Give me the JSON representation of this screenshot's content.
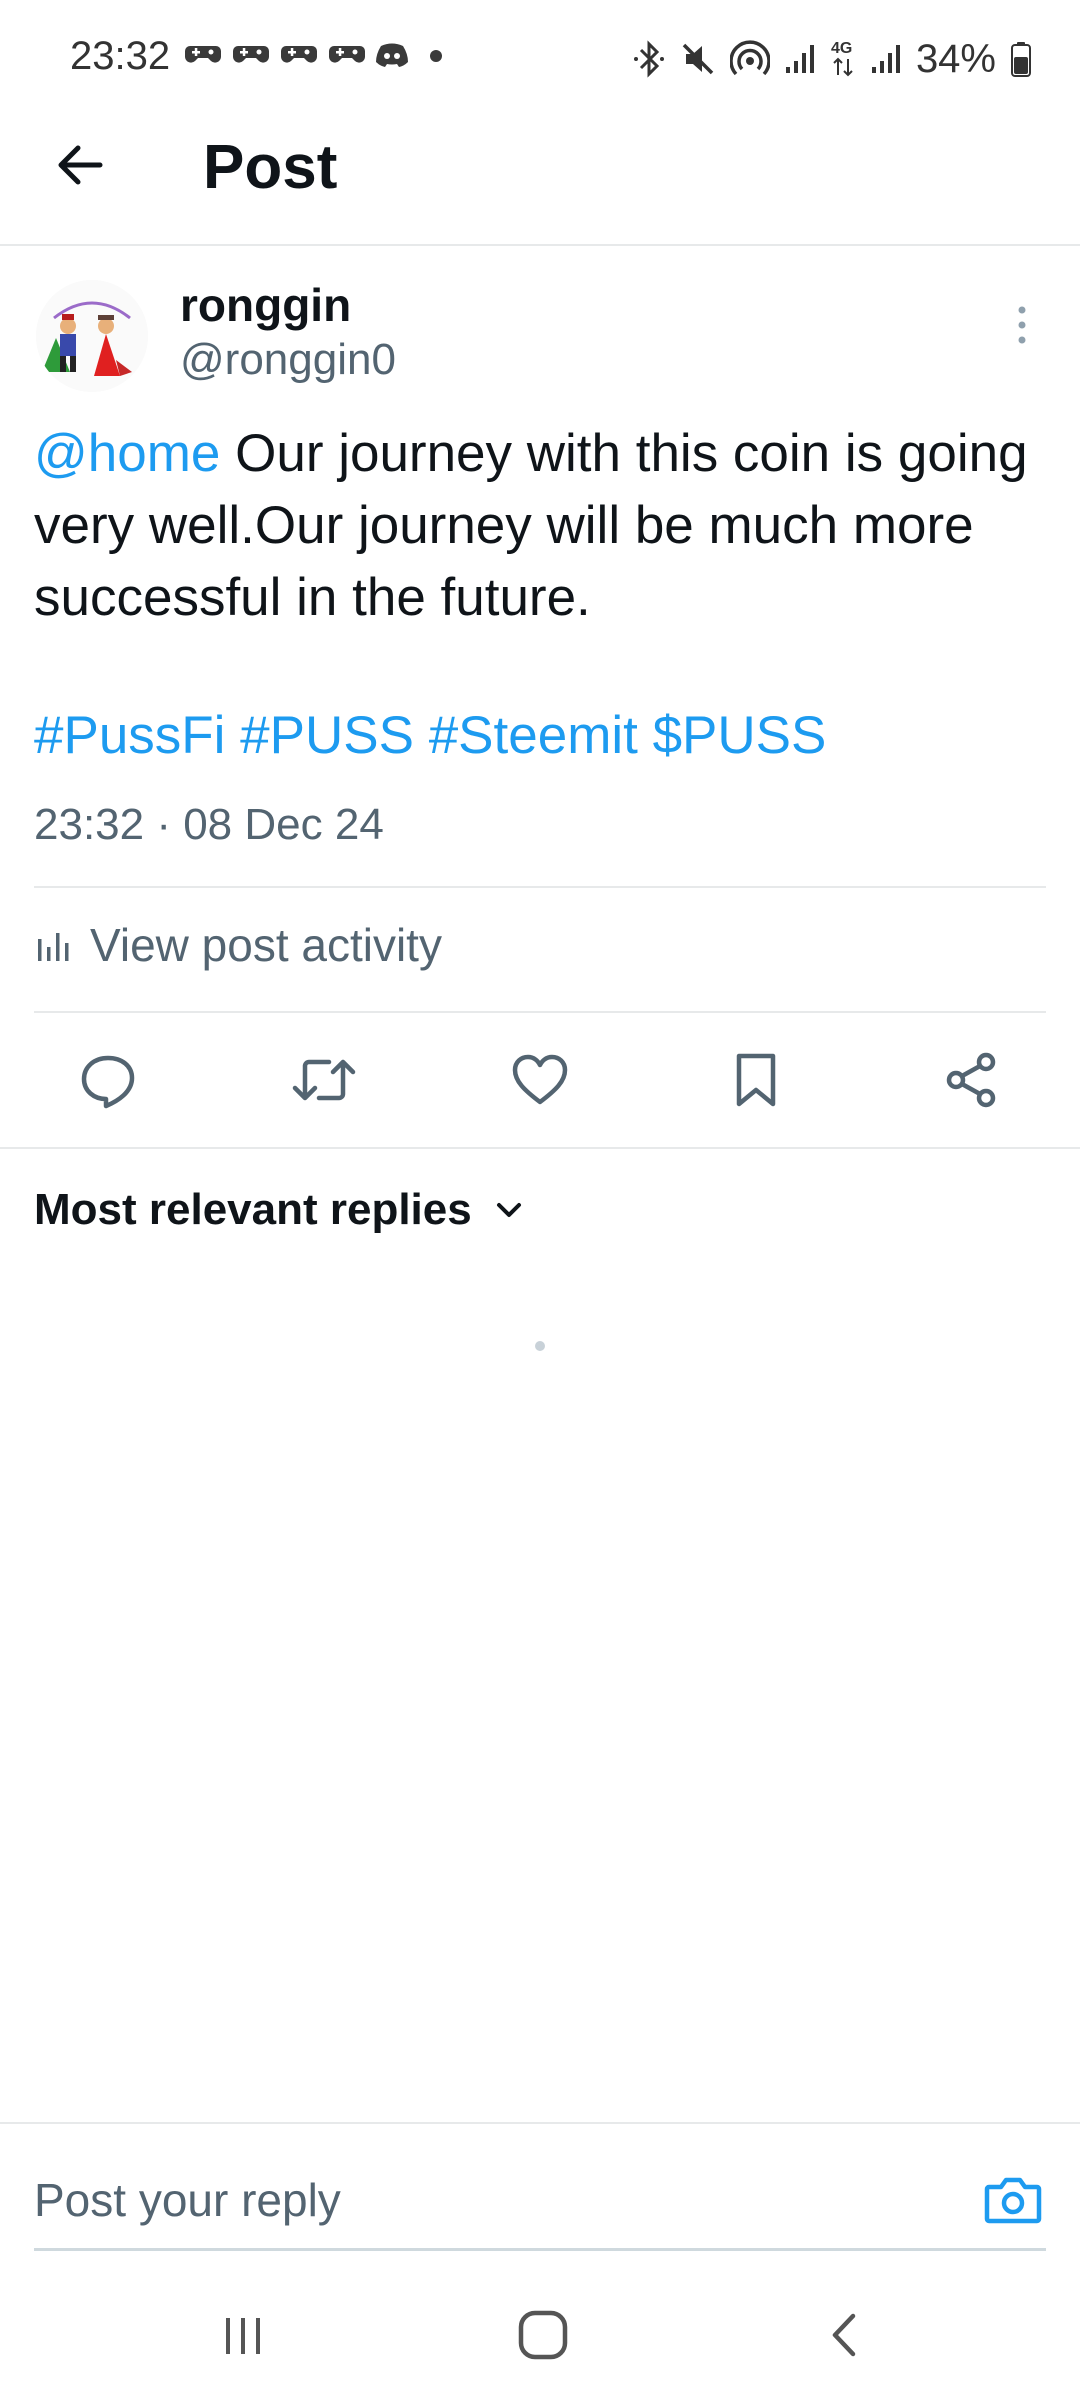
{
  "status_bar": {
    "time": "23:32",
    "battery": "34%",
    "notification_icons": [
      "game-controller-icon",
      "game-controller-icon",
      "game-controller-icon",
      "game-controller-icon",
      "discord-icon",
      "dot-icon"
    ],
    "system_icons": [
      "bluetooth-icon",
      "mute-icon",
      "hotspot-icon",
      "signal-icon",
      "4g-icon",
      "signal-icon",
      "battery-icon"
    ]
  },
  "header": {
    "title": "Post"
  },
  "post": {
    "author_name": "ronggin",
    "author_handle": "@ronggin0",
    "mention": "@home",
    "text": " Our journey with this coin is going very well.Our journey will be much more successful in the future.",
    "tags": "#PussFi #PUSS #Steemit $PUSS",
    "timestamp": "23:32 · 08 Dec 24"
  },
  "activity": {
    "label": "View post activity"
  },
  "actions": [
    "reply-icon",
    "repost-icon",
    "like-icon",
    "bookmark-icon",
    "share-icon"
  ],
  "replies": {
    "sort_label": "Most relevant replies"
  },
  "reply_bar": {
    "placeholder": "Post your reply"
  },
  "colors": {
    "link": "#1d9bf0",
    "text": "#0f1419",
    "secondary": "#536471",
    "divider": "#e7e9ea"
  }
}
